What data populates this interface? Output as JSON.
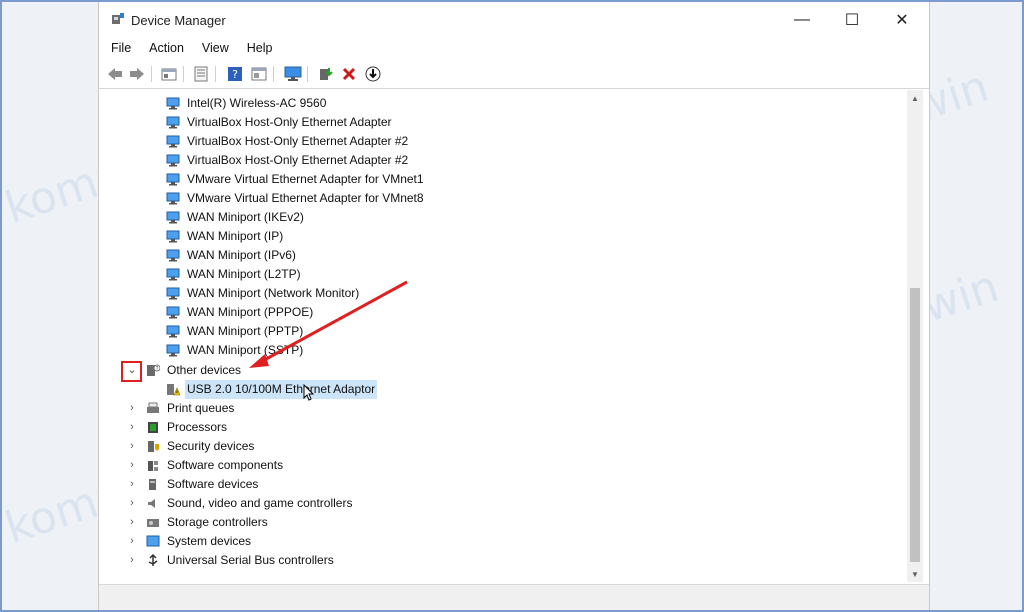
{
  "window": {
    "title": "Device Manager",
    "controls": {
      "minimize": "—",
      "maximize": "☐",
      "close": "✕"
    }
  },
  "menu": [
    "File",
    "Action",
    "View",
    "Help"
  ],
  "toolbar": {
    "buttons": [
      "back-icon",
      "forward-icon",
      "properties-icon",
      "list-icon",
      "help-icon",
      "view-icon",
      "monitor-icon",
      "update-driver-icon",
      "uninstall-icon",
      "download-icon"
    ]
  },
  "tree": {
    "network_items": [
      "Intel(R) Wireless-AC 9560",
      "VirtualBox Host-Only Ethernet Adapter",
      "VirtualBox Host-Only Ethernet Adapter #2",
      "VirtualBox Host-Only Ethernet Adapter #2",
      "VMware Virtual Ethernet Adapter for VMnet1",
      "VMware Virtual Ethernet Adapter for VMnet8",
      "WAN Miniport (IKEv2)",
      "WAN Miniport (IP)",
      "WAN Miniport (IPv6)",
      "WAN Miniport (L2TP)",
      "WAN Miniport (Network Monitor)",
      "WAN Miniport (PPPOE)",
      "WAN Miniport (PPTP)",
      "WAN Miniport (SSTP)"
    ],
    "other_devices": {
      "label": "Other devices",
      "expanded": true,
      "child": "USB 2.0 10/100M Ethernet Adaptor"
    },
    "categories": [
      "Print queues",
      "Processors",
      "Security devices",
      "Software components",
      "Software devices",
      "Sound, video and game controllers",
      "Storage controllers",
      "System devices",
      "Universal Serial Bus controllers"
    ]
  },
  "watermark": "kompiwin",
  "colors": {
    "annotation": "#e02020",
    "selection": "#cce4f7",
    "network_icon": "#2f7fd0"
  }
}
